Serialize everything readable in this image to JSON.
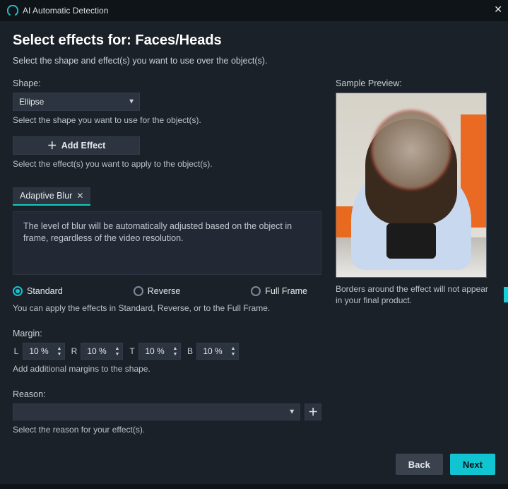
{
  "titlebar": {
    "title": "AI Automatic Detection"
  },
  "header": {
    "title": "Select effects for: Faces/Heads",
    "subtitle": "Select the shape and effect(s) you want to use over the object(s)."
  },
  "shape": {
    "label": "Shape:",
    "value": "Ellipse",
    "help": "Select the shape you want to use for the object(s)."
  },
  "addEffect": {
    "label": "Add Effect",
    "help": "Select the effect(s) you want to apply to the object(s)."
  },
  "effectTab": {
    "name": "Adaptive Blur",
    "description": "The level of blur will be automatically adjusted based on the object in frame, regardless of the video resolution."
  },
  "modes": {
    "options": [
      "Standard",
      "Reverse",
      "Full Frame"
    ],
    "selected": "Standard",
    "help": "You can apply the effects in Standard, Reverse, or to the Full Frame."
  },
  "margin": {
    "label": "Margin:",
    "dirs": {
      "L": "L",
      "R": "R",
      "T": "T",
      "B": "B"
    },
    "values": {
      "L": "10 %",
      "R": "10 %",
      "T": "10 %",
      "B": "10 %"
    },
    "help": "Add additional margins to the shape."
  },
  "reason": {
    "label": "Reason:",
    "value": "",
    "help": "Select the reason for your effect(s)."
  },
  "preview": {
    "label": "Sample Preview:",
    "help": "Borders around the effect will not appear in your final product."
  },
  "footer": {
    "back": "Back",
    "next": "Next"
  }
}
